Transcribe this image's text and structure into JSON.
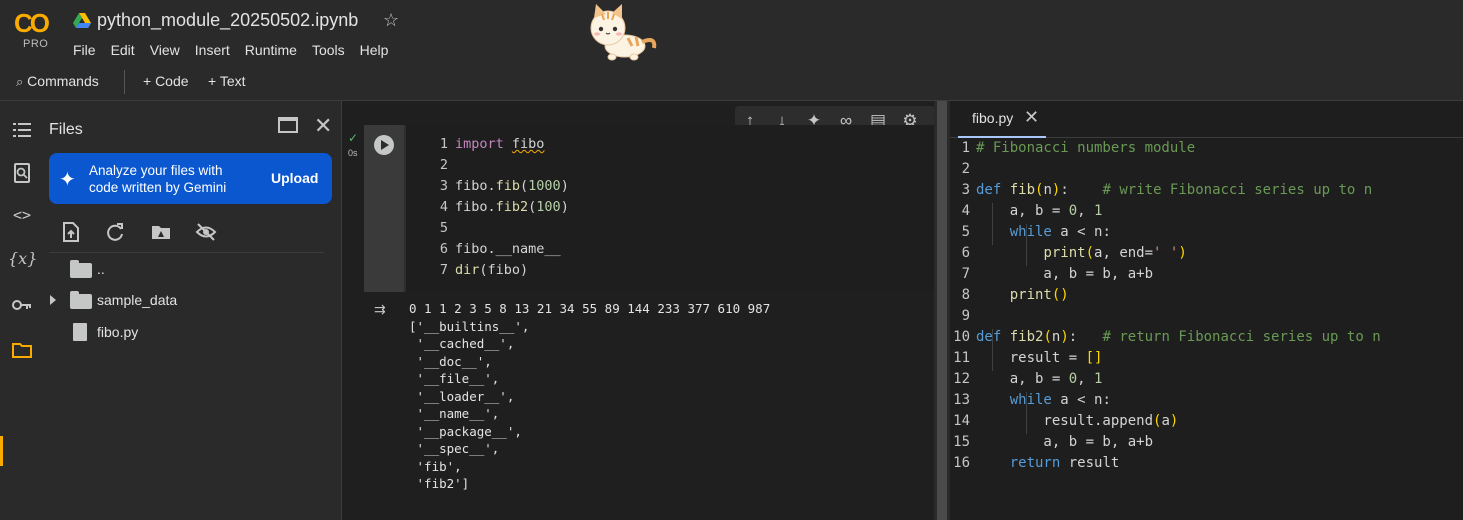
{
  "app": {
    "logo_text": "CO",
    "tier": "PRO",
    "notebook_title": "python_module_20250502.ipynb",
    "menu": [
      "File",
      "Edit",
      "View",
      "Insert",
      "Runtime",
      "Tools",
      "Help"
    ]
  },
  "toolbar": {
    "commands_label": "Commands",
    "add_code_label": "+ Code",
    "add_text_label": "+ Text"
  },
  "files_panel": {
    "title": "Files",
    "gemini_banner": {
      "line1": "Analyze your files with",
      "line2": "code written by Gemini",
      "action": "Upload"
    },
    "tree": [
      {
        "name": "..",
        "type": "parent-folder"
      },
      {
        "name": "sample_data",
        "type": "folder",
        "expandable": true
      },
      {
        "name": "fibo.py",
        "type": "file"
      }
    ]
  },
  "cell": {
    "status": "✓",
    "exec_time": "0s",
    "lines": [
      {
        "num": "1",
        "parts": [
          [
            "kw",
            "import"
          ],
          [
            "plain",
            " "
          ],
          [
            "ul",
            "fibo"
          ]
        ]
      },
      {
        "num": "2",
        "parts": []
      },
      {
        "num": "3",
        "parts": [
          [
            "plain",
            "fibo."
          ],
          [
            "fnc",
            "fib"
          ],
          [
            "plain",
            "("
          ],
          [
            "num",
            "1000"
          ],
          [
            "plain",
            ")"
          ]
        ]
      },
      {
        "num": "4",
        "parts": [
          [
            "plain",
            "fibo."
          ],
          [
            "fnc",
            "fib2"
          ],
          [
            "plain",
            "("
          ],
          [
            "num",
            "100"
          ],
          [
            "plain",
            ")"
          ]
        ]
      },
      {
        "num": "5",
        "parts": []
      },
      {
        "num": "6",
        "parts": [
          [
            "plain",
            "fibo.__name__"
          ]
        ]
      },
      {
        "num": "7",
        "parts": [
          [
            "fnc",
            "dir"
          ],
          [
            "plain",
            "(fibo)"
          ]
        ]
      }
    ],
    "output": [
      "0 1 1 2 3 5 8 13 21 34 55 89 144 233 377 610 987",
      "['__builtins__',",
      " '__cached__',",
      " '__doc__',",
      " '__file__',",
      " '__loader__',",
      " '__name__',",
      " '__package__',",
      " '__spec__',",
      " 'fib',",
      " 'fib2']"
    ]
  },
  "editor": {
    "tab_name": "fibo.py",
    "lines": [
      {
        "num": "1",
        "parts": [
          [
            "cmt",
            "# Fibonacci numbers module"
          ]
        ]
      },
      {
        "num": "2",
        "parts": []
      },
      {
        "num": "3",
        "parts": [
          [
            "kwb",
            "def"
          ],
          [
            "plain",
            " "
          ],
          [
            "fnc",
            "fib"
          ],
          [
            "paren",
            "("
          ],
          [
            "plain",
            "n"
          ],
          [
            "paren",
            ")"
          ],
          [
            "plain",
            ":    "
          ],
          [
            "cmt",
            "# write Fibonacci series up to n"
          ]
        ]
      },
      {
        "num": "4",
        "parts": [
          [
            "plain",
            "    a, b = "
          ],
          [
            "num",
            "0"
          ],
          [
            "plain",
            ", "
          ],
          [
            "num",
            "1"
          ]
        ]
      },
      {
        "num": "5",
        "parts": [
          [
            "plain",
            "    "
          ],
          [
            "kwb",
            "while"
          ],
          [
            "plain",
            " a < n:"
          ]
        ]
      },
      {
        "num": "6",
        "parts": [
          [
            "plain",
            "        "
          ],
          [
            "fnc",
            "print"
          ],
          [
            "paren",
            "("
          ],
          [
            "plain",
            "a, end="
          ],
          [
            "str",
            "' '"
          ],
          [
            "paren",
            ")"
          ]
        ]
      },
      {
        "num": "7",
        "parts": [
          [
            "plain",
            "        a, b = b, a+b"
          ]
        ]
      },
      {
        "num": "8",
        "parts": [
          [
            "plain",
            "    "
          ],
          [
            "fnc",
            "print"
          ],
          [
            "paren",
            "()"
          ]
        ]
      },
      {
        "num": "9",
        "parts": []
      },
      {
        "num": "10",
        "parts": [
          [
            "kwb",
            "def"
          ],
          [
            "plain",
            " "
          ],
          [
            "fnc",
            "fib2"
          ],
          [
            "paren",
            "("
          ],
          [
            "plain",
            "n"
          ],
          [
            "paren",
            ")"
          ],
          [
            "plain",
            ":   "
          ],
          [
            "cmt",
            "# return Fibonacci series up to n"
          ]
        ]
      },
      {
        "num": "11",
        "parts": [
          [
            "plain",
            "    result = "
          ],
          [
            "paren",
            "[]"
          ]
        ]
      },
      {
        "num": "12",
        "parts": [
          [
            "plain",
            "    a, b = "
          ],
          [
            "num",
            "0"
          ],
          [
            "plain",
            ", "
          ],
          [
            "num",
            "1"
          ]
        ]
      },
      {
        "num": "13",
        "parts": [
          [
            "plain",
            "    "
          ],
          [
            "kwb",
            "while"
          ],
          [
            "plain",
            " a < n:"
          ]
        ]
      },
      {
        "num": "14",
        "parts": [
          [
            "plain",
            "        result.append"
          ],
          [
            "paren",
            "("
          ],
          [
            "plain",
            "a"
          ],
          [
            "paren",
            ")"
          ]
        ]
      },
      {
        "num": "15",
        "parts": [
          [
            "plain",
            "        a, b = b, a+b"
          ]
        ]
      },
      {
        "num": "16",
        "parts": [
          [
            "plain",
            "    "
          ],
          [
            "kwb",
            "return"
          ],
          [
            "plain",
            " result"
          ]
        ]
      }
    ]
  },
  "colors": {
    "accent": "#f9ab00",
    "gemini_blue": "#0b57d0",
    "tab_underline": "#a8c7fa",
    "success": "#5bb974"
  }
}
